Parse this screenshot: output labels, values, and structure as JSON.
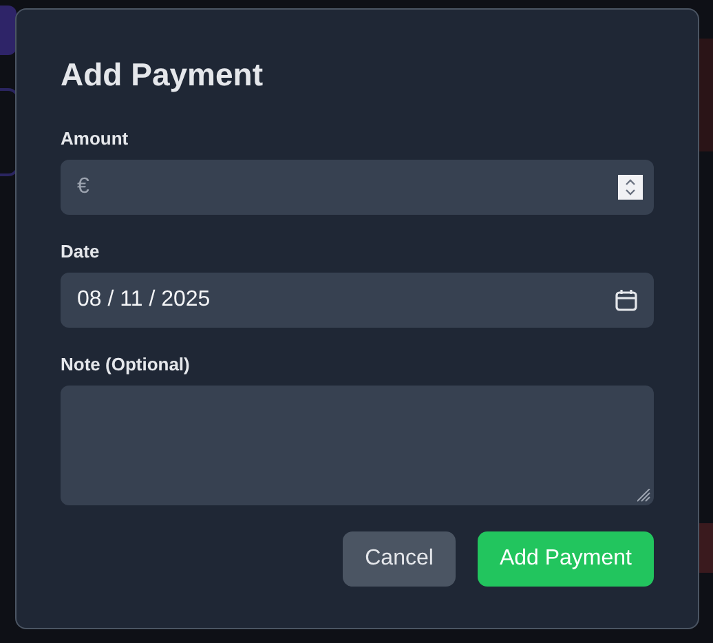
{
  "dialog": {
    "title": "Add Payment",
    "fields": [
      {
        "kind": "number",
        "label": "Amount",
        "prefix": "€"
      },
      {
        "kind": "date",
        "label": "Date",
        "value": "08 / 11 / 2025"
      },
      {
        "kind": "textarea",
        "label": "Note (Optional)"
      }
    ],
    "buttons": [
      {
        "label": "Cancel",
        "kind": "secondary"
      },
      {
        "label": "Add Payment",
        "kind": "primary"
      }
    ]
  }
}
